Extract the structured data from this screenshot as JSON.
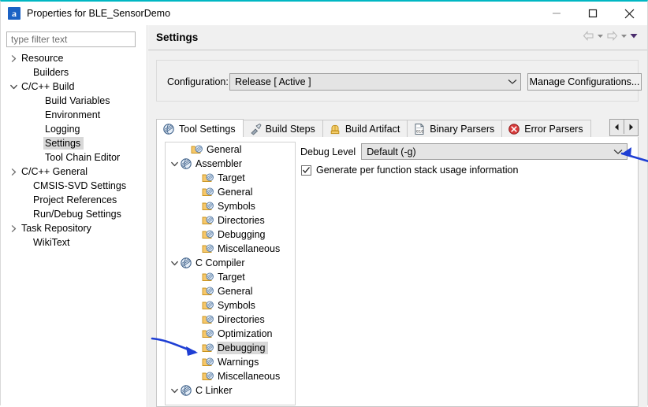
{
  "window": {
    "title": "Properties for BLE_SensorDemo",
    "icon": "eclipse-a-icon",
    "accent_color": "#00b7c3",
    "controls": {
      "minimize": "minimize-icon",
      "maximize": "maximize-icon",
      "close": "close-icon"
    }
  },
  "sidebar": {
    "filter": {
      "placeholder": "type filter text",
      "value": ""
    },
    "items": [
      {
        "label": "Resource",
        "indent": 0,
        "arrow": "collapsed",
        "selected": false
      },
      {
        "label": "Builders",
        "indent": 1,
        "arrow": "none",
        "selected": false
      },
      {
        "label": "C/C++ Build",
        "indent": 0,
        "arrow": "expanded",
        "selected": false
      },
      {
        "label": "Build Variables",
        "indent": 2,
        "arrow": "none",
        "selected": false
      },
      {
        "label": "Environment",
        "indent": 2,
        "arrow": "none",
        "selected": false
      },
      {
        "label": "Logging",
        "indent": 2,
        "arrow": "none",
        "selected": false
      },
      {
        "label": "Settings",
        "indent": 2,
        "arrow": "none",
        "selected": true
      },
      {
        "label": "Tool Chain Editor",
        "indent": 2,
        "arrow": "none",
        "selected": false
      },
      {
        "label": "C/C++ General",
        "indent": 0,
        "arrow": "collapsed",
        "selected": false
      },
      {
        "label": "CMSIS-SVD Settings",
        "indent": 1,
        "arrow": "none",
        "selected": false
      },
      {
        "label": "Project References",
        "indent": 1,
        "arrow": "none",
        "selected": false
      },
      {
        "label": "Run/Debug Settings",
        "indent": 1,
        "arrow": "none",
        "selected": false
      },
      {
        "label": "Task Repository",
        "indent": 0,
        "arrow": "collapsed",
        "selected": false
      },
      {
        "label": "WikiText",
        "indent": 1,
        "arrow": "none",
        "selected": false
      }
    ]
  },
  "page": {
    "title": "Settings",
    "nav": {
      "back": "back-arrow-icon",
      "back_menu": "chevron-down-icon",
      "forward": "forward-arrow-icon",
      "forward_menu": "chevron-down-icon",
      "view_menu": "view-menu-icon"
    }
  },
  "configuration": {
    "label": "Configuration:",
    "value": "Release  [ Active ]",
    "manage_button": "Manage Configurations..."
  },
  "tabs": {
    "items": [
      {
        "label": "Tool Settings",
        "icon": "tool-settings-icon",
        "active": true
      },
      {
        "label": "Build Steps",
        "icon": "build-steps-icon",
        "active": false
      },
      {
        "label": "Build Artifact",
        "icon": "build-artifact-icon",
        "active": false
      },
      {
        "label": "Binary Parsers",
        "icon": "binary-parsers-icon",
        "active": false
      },
      {
        "label": "Error Parsers",
        "icon": "error-parsers-icon",
        "active": false
      }
    ],
    "scroll_left": "scroll-left-icon",
    "scroll_right": "scroll-right-icon"
  },
  "tool_tree": {
    "items": [
      {
        "label": "General",
        "indent": 1,
        "arrow": "none",
        "icon": "folder-tool-icon",
        "selected": false
      },
      {
        "label": "Assembler",
        "indent": 0,
        "arrow": "expanded",
        "icon": "tool-globe-icon",
        "selected": false
      },
      {
        "label": "Target",
        "indent": 2,
        "arrow": "none",
        "icon": "folder-tool-icon",
        "selected": false
      },
      {
        "label": "General",
        "indent": 2,
        "arrow": "none",
        "icon": "folder-tool-icon",
        "selected": false
      },
      {
        "label": "Symbols",
        "indent": 2,
        "arrow": "none",
        "icon": "folder-tool-icon",
        "selected": false
      },
      {
        "label": "Directories",
        "indent": 2,
        "arrow": "none",
        "icon": "folder-tool-icon",
        "selected": false
      },
      {
        "label": "Debugging",
        "indent": 2,
        "arrow": "none",
        "icon": "folder-tool-icon",
        "selected": false
      },
      {
        "label": "Miscellaneous",
        "indent": 2,
        "arrow": "none",
        "icon": "folder-tool-icon",
        "selected": false
      },
      {
        "label": "C Compiler",
        "indent": 0,
        "arrow": "expanded",
        "icon": "tool-globe-icon",
        "selected": false
      },
      {
        "label": "Target",
        "indent": 2,
        "arrow": "none",
        "icon": "folder-tool-icon",
        "selected": false
      },
      {
        "label": "General",
        "indent": 2,
        "arrow": "none",
        "icon": "folder-tool-icon",
        "selected": false
      },
      {
        "label": "Symbols",
        "indent": 2,
        "arrow": "none",
        "icon": "folder-tool-icon",
        "selected": false
      },
      {
        "label": "Directories",
        "indent": 2,
        "arrow": "none",
        "icon": "folder-tool-icon",
        "selected": false
      },
      {
        "label": "Optimization",
        "indent": 2,
        "arrow": "none",
        "icon": "folder-tool-icon",
        "selected": false
      },
      {
        "label": "Debugging",
        "indent": 2,
        "arrow": "none",
        "icon": "folder-tool-icon",
        "selected": true
      },
      {
        "label": "Warnings",
        "indent": 2,
        "arrow": "none",
        "icon": "folder-tool-icon",
        "selected": false
      },
      {
        "label": "Miscellaneous",
        "indent": 2,
        "arrow": "none",
        "icon": "folder-tool-icon",
        "selected": false
      },
      {
        "label": "C Linker",
        "indent": 0,
        "arrow": "expanded",
        "icon": "tool-globe-icon",
        "selected": false
      }
    ]
  },
  "tool_detail": {
    "debug_level": {
      "label": "Debug Level",
      "value": "Default (-g)"
    },
    "stack_usage": {
      "label": "Generate per function stack usage information",
      "checked": true
    }
  },
  "annotations": {
    "color": "#1f3fd4",
    "items": [
      {
        "name": "arrow-pointing-to-debug-level-dropdown"
      },
      {
        "name": "arrow-pointing-to-debugging-node"
      }
    ]
  }
}
